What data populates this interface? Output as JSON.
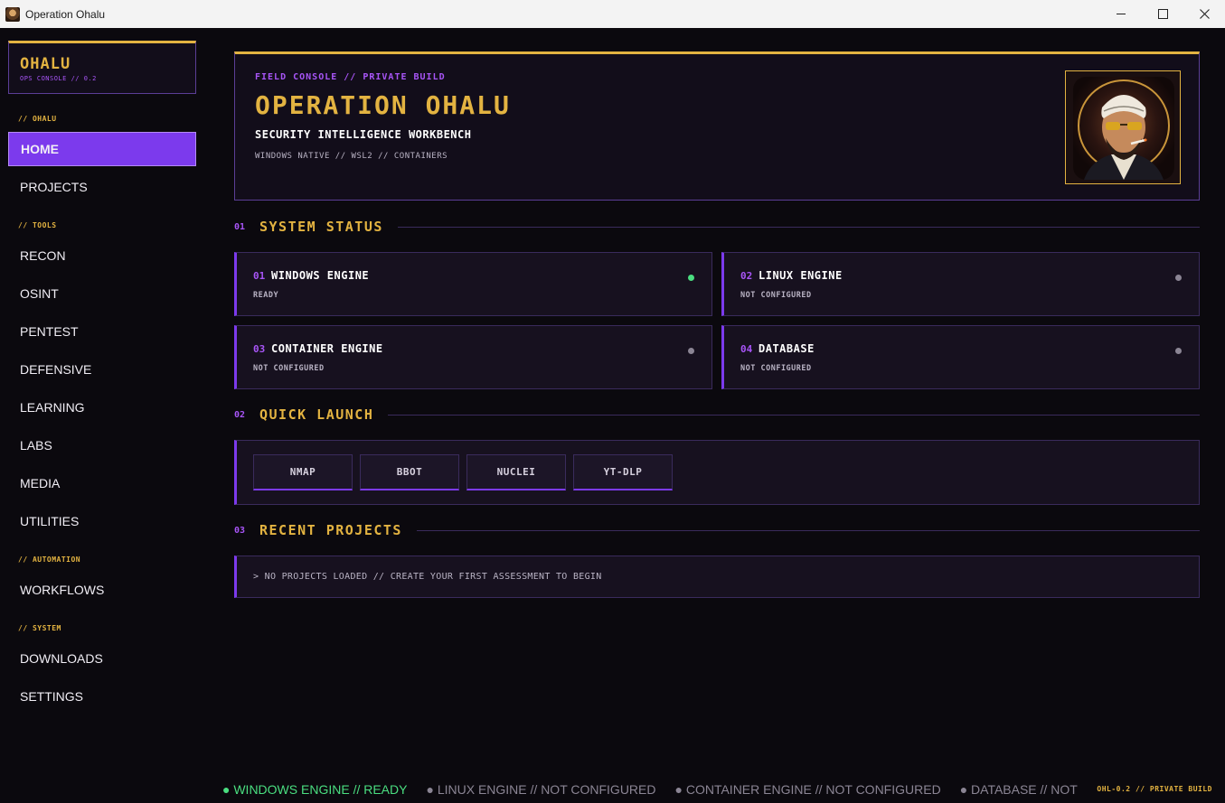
{
  "window": {
    "title": "Operation Ohalu"
  },
  "sidebar": {
    "brand_name": "OHALU",
    "brand_sub": "OPS CONSOLE // 0.2",
    "sections": {
      "ohalu": "// OHALU",
      "tools": "// TOOLS",
      "automation": "// AUTOMATION",
      "system": "// SYSTEM"
    },
    "items": {
      "home": "HOME",
      "projects": "PROJECTS",
      "recon": "RECON",
      "osint": "OSINT",
      "pentest": "PENTEST",
      "defensive": "DEFENSIVE",
      "learning": "LEARNING",
      "labs": "LABS",
      "media": "MEDIA",
      "utilities": "UTILITIES",
      "workflows": "WORKFLOWS",
      "downloads": "DOWNLOADS",
      "settings": "SETTINGS"
    },
    "active_item": "HOME"
  },
  "hero": {
    "kicker": "FIELD CONSOLE // PRIVATE BUILD",
    "title": "OPERATION OHALU",
    "subtitle": "SECURITY INTELLIGENCE WORKBENCH",
    "meta": "WINDOWS NATIVE // WSL2 // CONTAINERS"
  },
  "system_status": {
    "num": "01",
    "title": "SYSTEM STATUS",
    "cards": [
      {
        "num": "01",
        "title": "WINDOWS ENGINE",
        "state": "READY",
        "status": "ok"
      },
      {
        "num": "02",
        "title": "LINUX ENGINE",
        "state": "NOT CONFIGURED",
        "status": "off"
      },
      {
        "num": "03",
        "title": "CONTAINER ENGINE",
        "state": "NOT CONFIGURED",
        "status": "off"
      },
      {
        "num": "04",
        "title": "DATABASE",
        "state": "NOT CONFIGURED",
        "status": "off"
      }
    ]
  },
  "quick_launch": {
    "num": "02",
    "title": "QUICK LAUNCH",
    "buttons": [
      "NMAP",
      "BBOT",
      "NUCLEI",
      "YT-DLP"
    ]
  },
  "recent_projects": {
    "num": "03",
    "title": "RECENT PROJECTS",
    "empty_text": "> NO PROJECTS LOADED // CREATE YOUR FIRST ASSESSMENT TO BEGIN"
  },
  "footer": {
    "ticker": [
      "● WINDOWS ENGINE // READY",
      "● LINUX ENGINE // NOT CONFIGURED",
      "● CONTAINER ENGINE // NOT CONFIGURED",
      "● DATABASE // NOT CONFIGURED"
    ],
    "build": "OHL-0.2 // PRIVATE BUILD"
  },
  "colors": {
    "accent_gold": "#e3b341",
    "accent_purple": "#7c3aed",
    "status_ok": "#4ade80",
    "status_off": "#8b8594"
  }
}
